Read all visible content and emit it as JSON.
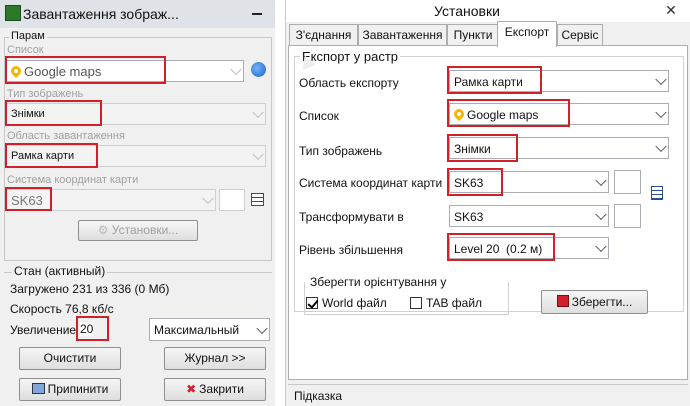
{
  "left": {
    "title": "Завантаження зображ...",
    "group_label": "Парам",
    "list": {
      "label": "Список",
      "value": "Google maps"
    },
    "image_type": {
      "label": "Тип зображень",
      "value": "Знімки"
    },
    "area": {
      "label": "Область завантаження",
      "value": "Рамка карти"
    },
    "crs": {
      "label": "Система координат карти",
      "value": "SK63"
    },
    "settings_button": "Установки...",
    "status": {
      "title": "Стан (активный)",
      "loaded": "Загружено 231 из 336 (0 Мб)",
      "speed": "Скорость 76,8 кб/с",
      "zoom_label": "Увеличение",
      "zoom_value": "20",
      "zoom_mode": "Максимальный"
    },
    "buttons": {
      "clear": "Очистити",
      "log": "Журнал >>",
      "stop": "Припинити",
      "close": "Закрити"
    }
  },
  "right": {
    "title": "Установки",
    "tabs": [
      "З'єднання",
      "Завантаження",
      "Пункти",
      "Експорт",
      "Сервіс"
    ],
    "active_tab": "Експорт",
    "group_label": "Експорт у растр",
    "rows": [
      {
        "label": "Область експорту",
        "value": "Рамка карти"
      },
      {
        "label": "Список",
        "value": "Google maps"
      },
      {
        "label": "Тип зображень",
        "value": "Знімки"
      },
      {
        "label": "Система координат карти",
        "value": "SK63"
      },
      {
        "label": "Трансформувати в",
        "value": "SK63"
      },
      {
        "label": "Рівень збільшення",
        "value": "Level 20  (0.2 м)"
      }
    ],
    "orient": {
      "label": "Зберегти орієнтування у",
      "world": "World файл",
      "world_checked": true,
      "tab": "TAB файл",
      "tab_checked": false
    },
    "save_button": "Зберегти...",
    "hint_label": "Підказка"
  },
  "colors": {
    "highlight": "#d0202a",
    "map_pin": "#f2b705"
  }
}
